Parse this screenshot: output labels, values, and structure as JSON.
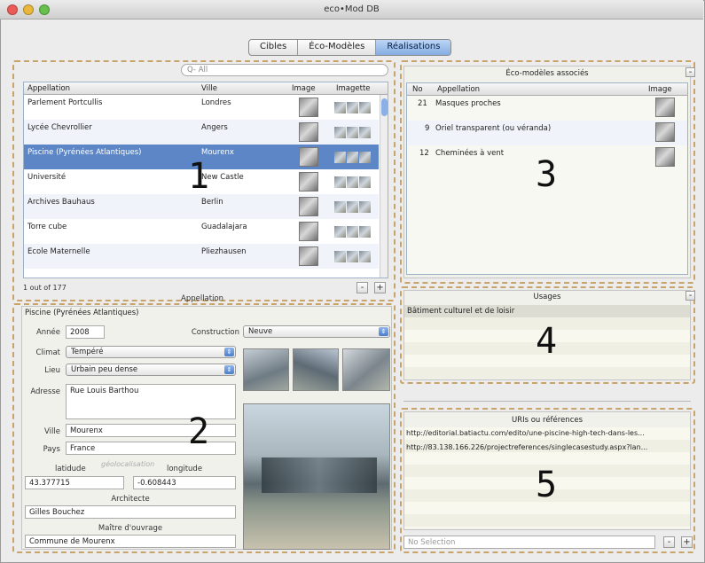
{
  "window": {
    "title": "eco•Mod DB"
  },
  "segments": [
    {
      "label": "Cibles"
    },
    {
      "label": "Éco-Modèles"
    },
    {
      "label": "Réalisations"
    }
  ],
  "search": {
    "placeholder": "Q- All"
  },
  "list": {
    "columns": [
      "Appellation",
      "Ville",
      "Image",
      "Imagette"
    ],
    "rows": [
      {
        "name": "Parlement Portcullis",
        "city": "Londres"
      },
      {
        "name": "Lycée Chevrollier",
        "city": "Angers"
      },
      {
        "name": "Piscine (Pyrénées Atlantiques)",
        "city": "Mourenx"
      },
      {
        "name": "Université",
        "city": "New Castle"
      },
      {
        "name": "Archives Bauhaus",
        "city": "Berlin"
      },
      {
        "name": "Torre cube",
        "city": "Guadalajara"
      },
      {
        "name": "Ecole Maternelle",
        "city": "Pliezhausen"
      }
    ],
    "count": "1 out of 177",
    "sort_label": "Appellation"
  },
  "detail": {
    "title": "Piscine (Pyrénées Atlantiques)",
    "annee_label": "Année",
    "annee": "2008",
    "construction_label": "Construction",
    "construction": "Neuve",
    "climat_label": "Climat",
    "climat": "Tempéré",
    "lieu_label": "Lieu",
    "lieu": "Urbain peu dense",
    "adresse_label": "Adresse",
    "adresse": "Rue Louis Barthou",
    "ville_label": "Ville",
    "ville": "Mourenx",
    "pays_label": "Pays",
    "pays": "France",
    "latitude_label": "latidude",
    "geo_label": "géolocalisation",
    "longitude_label": "longitude",
    "latitude": "43.377715",
    "longitude": "-0.608443",
    "architecte_label": "Architecte",
    "architecte": "Gilles Bouchez",
    "maitre_label": "Maître d'ouvrage",
    "maitre": "Commune de Mourenx"
  },
  "eco": {
    "title": "Éco-modèles associés",
    "columns": [
      "No",
      "Appellation",
      "Image"
    ],
    "rows": [
      {
        "no": "21",
        "name": "Masques proches"
      },
      {
        "no": "9",
        "name": "Oriel transparent (ou véranda)"
      },
      {
        "no": "12",
        "name": "Cheminées à vent"
      }
    ]
  },
  "usages": {
    "title": "Usages",
    "rows": [
      "Bâtiment culturel et de loisir"
    ]
  },
  "uris": {
    "title": "URIs ou références",
    "rows": [
      "http://editorial.batiactu.com/edito/une-piscine-high-tech-dans-les...",
      "http://83.138.166.226/projectreferences/singlecasestudy.aspx?lan..."
    ],
    "status": "No Selection"
  },
  "markers": [
    "1",
    "2",
    "3",
    "4",
    "5"
  ],
  "buttons": {
    "minus": "-",
    "plus": "+"
  },
  "colors": {
    "accent": "#5c86c6",
    "dashed_border": "#c9a46a"
  }
}
